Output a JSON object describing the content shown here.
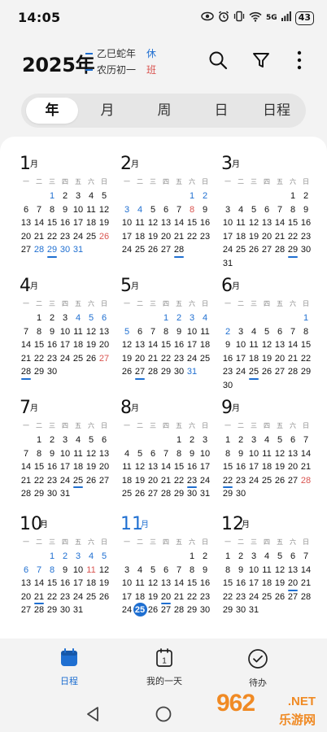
{
  "status": {
    "time": "14:05",
    "signal": "5G",
    "battery": "43"
  },
  "header": {
    "year_title": "2025年",
    "lunar_year": "乙巳蛇年",
    "lunar_day": "农历初一",
    "tag_rest": "休",
    "tag_work": "班"
  },
  "tabs": [
    {
      "label": "年",
      "active": true
    },
    {
      "label": "月",
      "active": false
    },
    {
      "label": "周",
      "active": false
    },
    {
      "label": "日",
      "active": false
    },
    {
      "label": "日程",
      "active": false
    }
  ],
  "weekdays": [
    "一",
    "二",
    "三",
    "四",
    "五",
    "六",
    "日"
  ],
  "month_suffix": "月",
  "months": [
    {
      "num": "1",
      "offset": 2,
      "days": 31,
      "rest": [
        1,
        28,
        29,
        30,
        31
      ],
      "work": [
        26
      ],
      "underline": [
        29
      ],
      "today": null
    },
    {
      "num": "2",
      "offset": 5,
      "days": 28,
      "rest": [
        1,
        2,
        3,
        4
      ],
      "work": [
        8
      ],
      "underline": [
        28
      ],
      "today": null
    },
    {
      "num": "3",
      "offset": 5,
      "days": 31,
      "rest": [],
      "work": [],
      "underline": [
        29
      ],
      "today": null
    },
    {
      "num": "4",
      "offset": 1,
      "days": 30,
      "rest": [
        4,
        5,
        6
      ],
      "work": [
        27
      ],
      "underline": [
        28
      ],
      "today": null
    },
    {
      "num": "5",
      "offset": 3,
      "days": 31,
      "rest": [
        1,
        2,
        3,
        4,
        5,
        31
      ],
      "work": [],
      "underline": [
        27
      ],
      "today": null
    },
    {
      "num": "6",
      "offset": 6,
      "days": 30,
      "rest": [
        1,
        2
      ],
      "work": [],
      "underline": [
        25
      ],
      "today": null
    },
    {
      "num": "7",
      "offset": 1,
      "days": 31,
      "rest": [],
      "work": [],
      "underline": [
        25
      ],
      "today": null
    },
    {
      "num": "8",
      "offset": 4,
      "days": 31,
      "rest": [],
      "work": [],
      "underline": [
        23
      ],
      "today": null
    },
    {
      "num": "9",
      "offset": 0,
      "days": 30,
      "rest": [],
      "work": [
        28
      ],
      "underline": [
        22
      ],
      "today": null
    },
    {
      "num": "10",
      "offset": 2,
      "days": 31,
      "rest": [
        1,
        2,
        3,
        4,
        5,
        6,
        7,
        8
      ],
      "work": [
        11
      ],
      "underline": [
        21
      ],
      "today": null
    },
    {
      "num": "11",
      "offset": 5,
      "days": 30,
      "rest": [],
      "work": [],
      "underline": [
        20
      ],
      "today": 25,
      "current": true
    },
    {
      "num": "12",
      "offset": 0,
      "days": 31,
      "rest": [],
      "work": [],
      "underline": [
        20
      ],
      "today": null
    }
  ],
  "bottom_nav": [
    {
      "label": "日程",
      "icon": "calendar-icon",
      "active": true
    },
    {
      "label": "我的一天",
      "icon": "my-day-icon",
      "active": false
    },
    {
      "label": "待办",
      "icon": "todo-check-icon",
      "active": false
    }
  ],
  "today_icon_num": "1",
  "watermark": {
    "brand": "962",
    "suffix": ".NET",
    "site": "乐游网"
  }
}
